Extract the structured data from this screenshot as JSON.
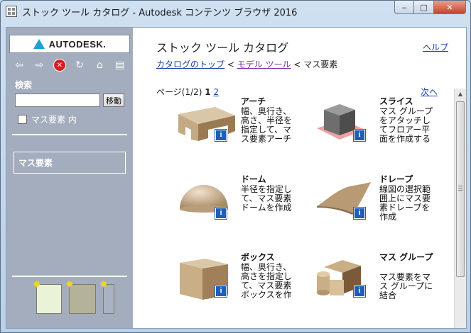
{
  "window": {
    "title": "ストック ツール カタログ - Autodesk コンテンツ ブラウザ 2016",
    "minimize": "‒",
    "maximize": "□",
    "close": "✕"
  },
  "sidebar": {
    "logo_text": "AUTODESK.",
    "nav": {
      "back": "⇦",
      "forward": "⇨",
      "stop": "✕",
      "refresh": "↻",
      "home": "⌂",
      "print": "▤"
    },
    "search_label": "検索",
    "search_value": "",
    "search_button": "移動",
    "within_label": "マス要素 内",
    "within_checked": false,
    "current_path": "マス要素"
  },
  "main": {
    "title": "ストック ツール カタログ",
    "help": "ヘルプ",
    "breadcrumb": {
      "top": "カタログのトップ",
      "sep1": " < ",
      "model": "モデル ツール",
      "sep2": " < ",
      "current": "マス要素"
    },
    "pager": {
      "label": "ページ(1/2) ",
      "current": "1",
      "other": "2",
      "next": "次へ"
    },
    "tiles": [
      {
        "title": "アーチ",
        "desc": "幅、奥行き、高さ、半径を指定して、マス要素アーチを作成"
      },
      {
        "title": "スライス",
        "desc": "マス グループをアタッチしてフロアー平面を作成するスライス"
      },
      {
        "title": "ドーム",
        "desc": "半径を指定して、マス要素ドームを作成"
      },
      {
        "title": "ドレープ",
        "desc": "線図の選択範囲上にマス要素ドレープを作成"
      },
      {
        "title": "ボックス",
        "desc": "幅、奥行き、高さを指定して、マス要素ボックスを作成"
      },
      {
        "title": "マス グループ",
        "desc": "マス要素をマス グループに結合"
      }
    ],
    "info_glyph": "i"
  }
}
